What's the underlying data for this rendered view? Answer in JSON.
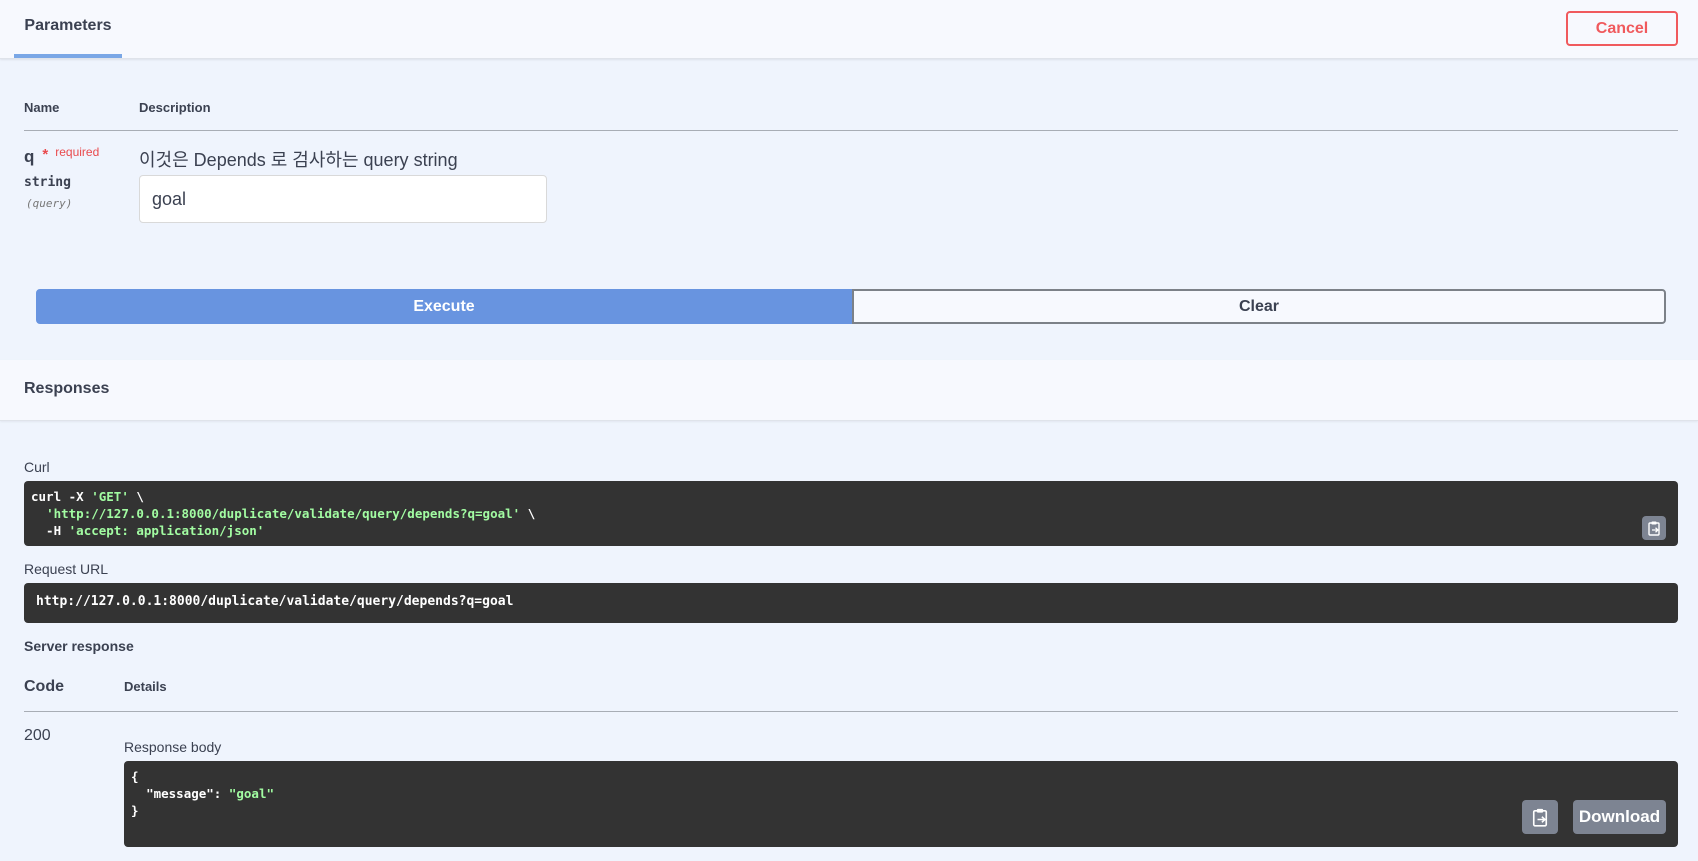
{
  "parameters": {
    "tab_label": "Parameters",
    "cancel_label": "Cancel",
    "columns": {
      "name": "Name",
      "description": "Description"
    },
    "param": {
      "name": "q",
      "required_star": "*",
      "required_label": "required",
      "type": "string",
      "in": "(query)",
      "description": "이것은 Depends 로 검사하는 query string",
      "value": "goal"
    },
    "execute_label": "Execute",
    "clear_label": "Clear"
  },
  "responses": {
    "title": "Responses",
    "curl_label": "Curl",
    "curl_lines": [
      {
        "plain1": "curl -X ",
        "str": "'GET'",
        "plain2": " \\"
      },
      {
        "plain1": "  ",
        "str": "'http://127.0.0.1:8000/duplicate/validate/query/depends?q=goal'",
        "plain2": " \\"
      },
      {
        "plain1": "  -H ",
        "str": "'accept: application/json'",
        "plain2": ""
      }
    ],
    "request_url_label": "Request URL",
    "request_url": "http://127.0.0.1:8000/duplicate/validate/query/depends?q=goal",
    "server_response_label": "Server response",
    "columns": {
      "code": "Code",
      "details": "Details"
    },
    "code": "200",
    "response_body_label": "Response body",
    "body_lines": [
      {
        "plain1": "{",
        "key": "",
        "sep": "",
        "str": ""
      },
      {
        "plain1": "  ",
        "key": "\"message\"",
        "sep": ": ",
        "str": "\"goal\""
      },
      {
        "plain1": "}",
        "key": "",
        "sep": "",
        "str": ""
      }
    ],
    "download_label": "Download"
  },
  "icons": {
    "copy": "clipboard-icon"
  },
  "colors": {
    "accent_blue": "#6894e0",
    "cancel_red": "#f05a5d",
    "code_bg": "#333333",
    "code_string": "#a2fca2"
  }
}
